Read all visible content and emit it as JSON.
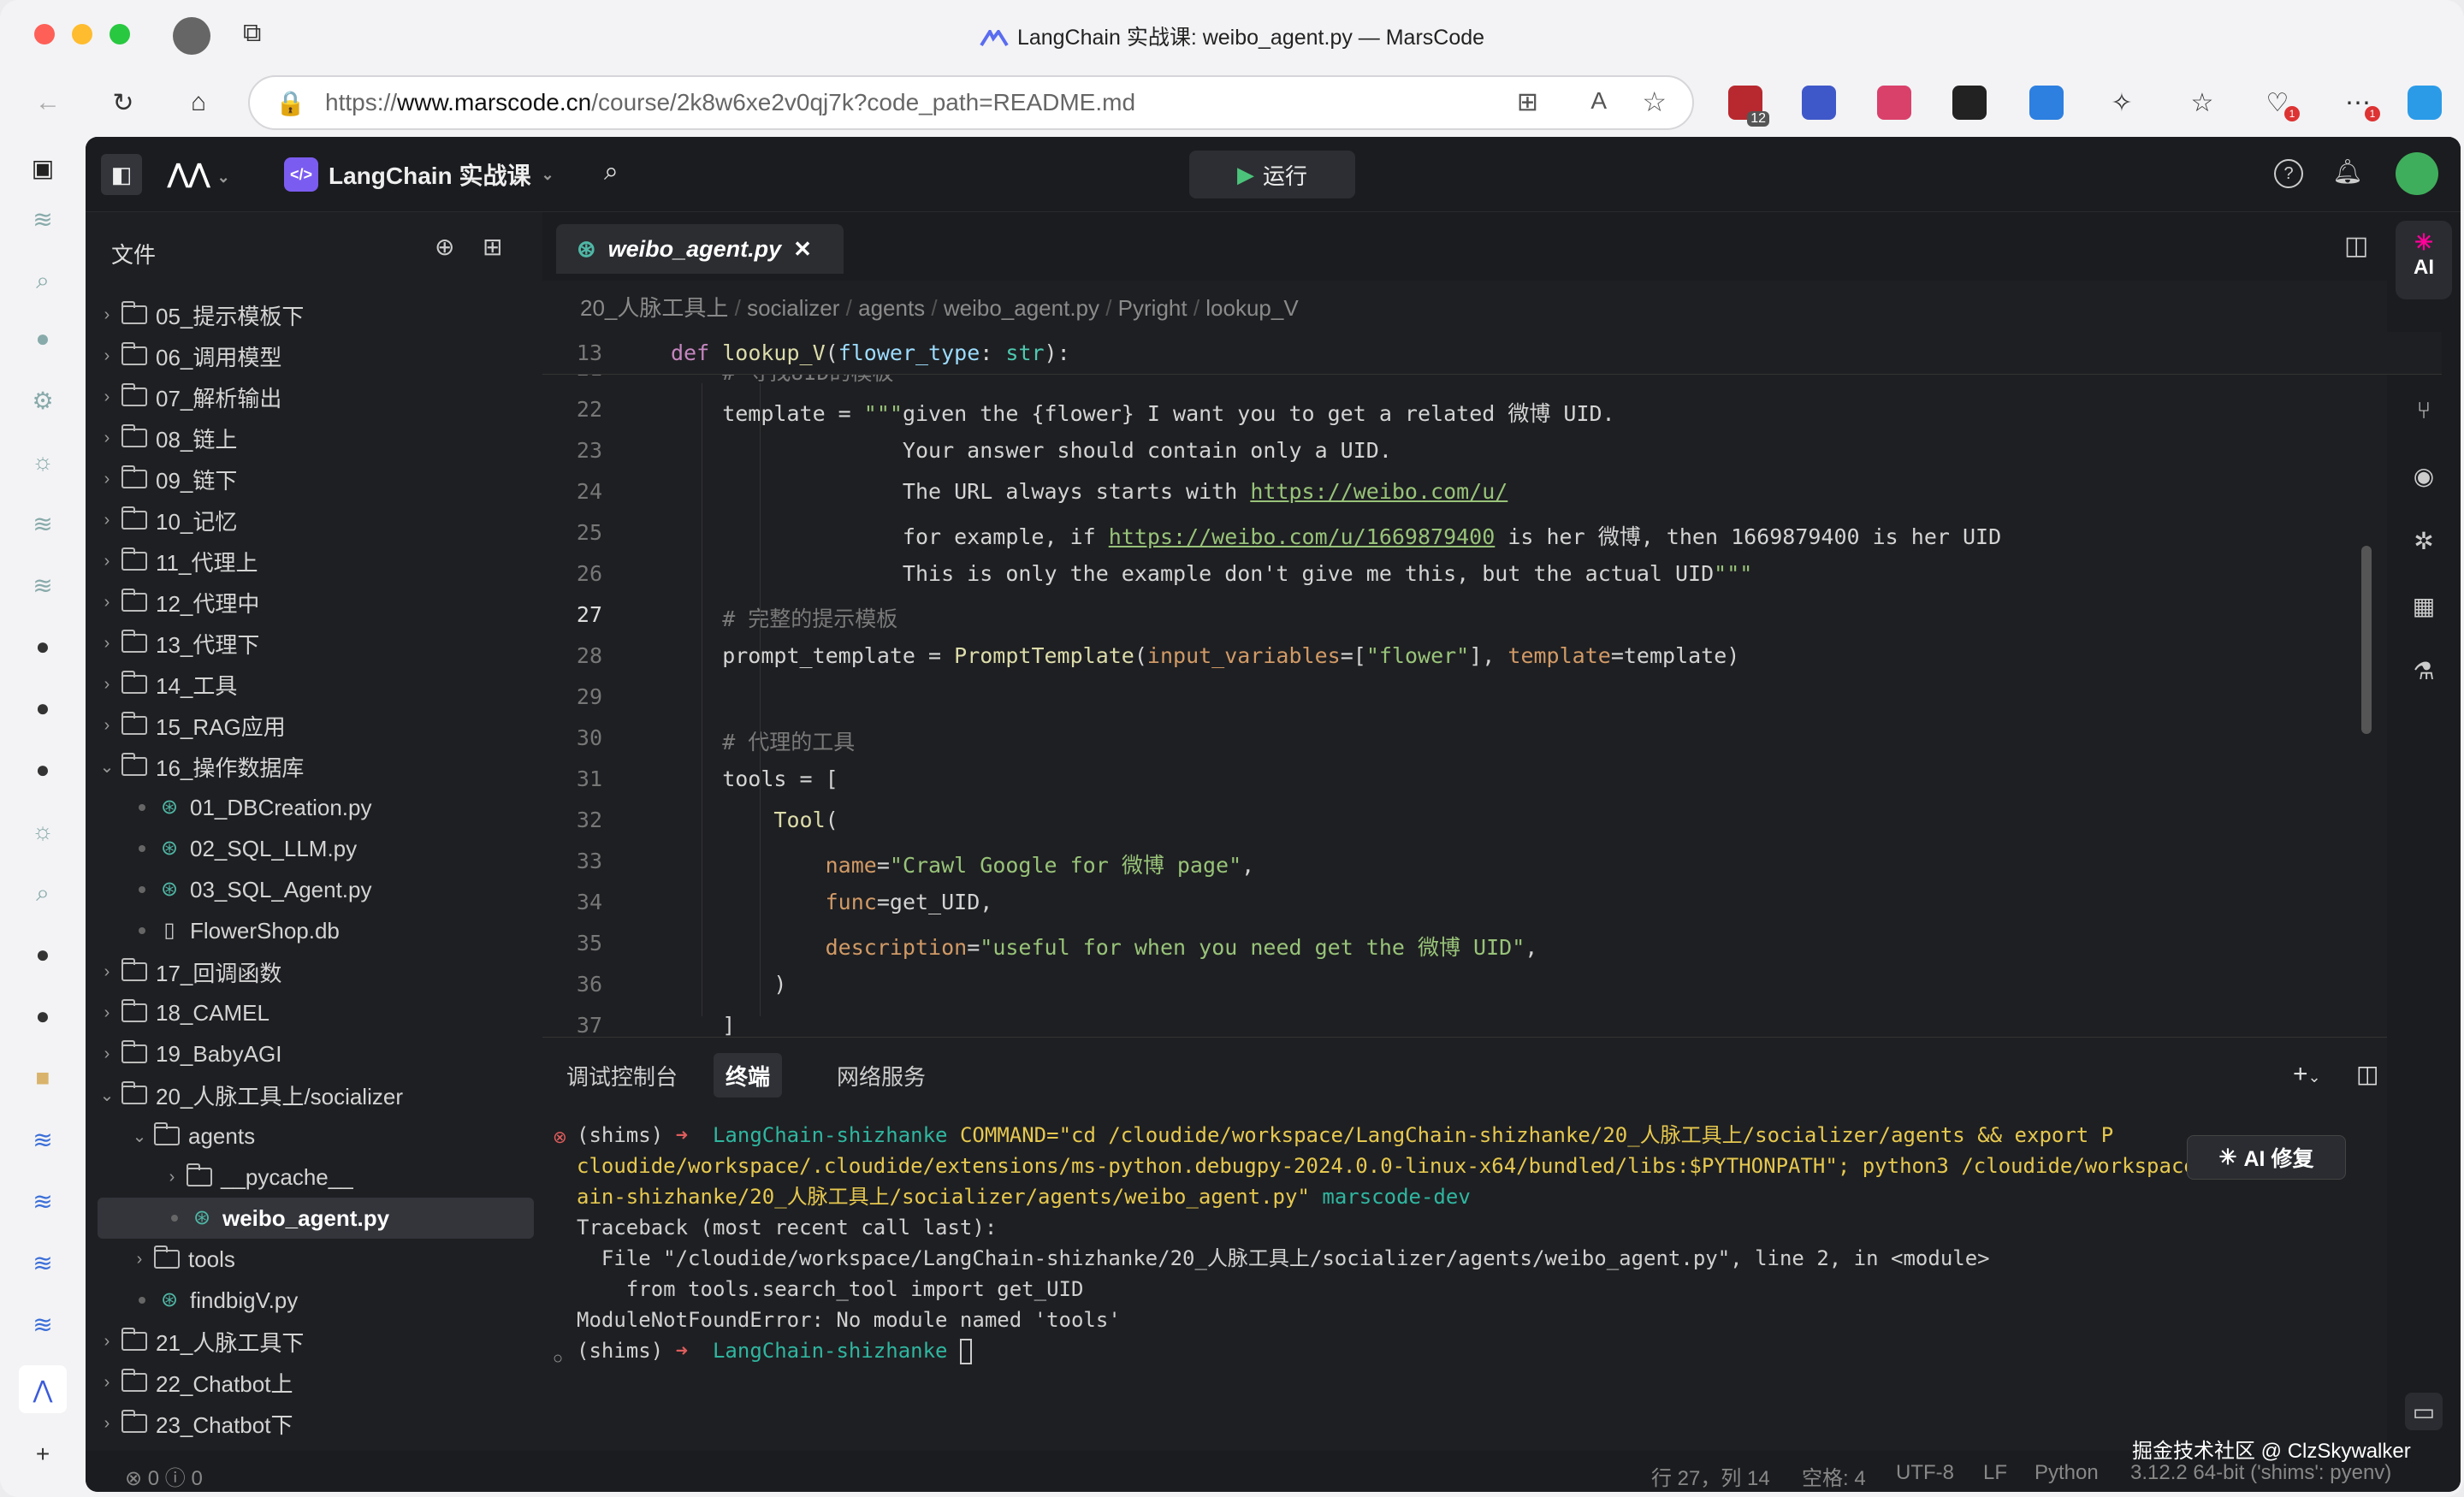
{
  "window": {
    "title": "LangChain 实战课: weibo_agent.py — MarsCode"
  },
  "browser": {
    "url_scheme": "https://",
    "url_host": "www.marscode.cn",
    "url_path": "/course/2k8w6xe2v0qj7k?code_path=README.md",
    "ext_badge_1": "12",
    "ext_badge_2": "1",
    "ext_badge_3": "1"
  },
  "ide": {
    "project": "LangChain 实战课",
    "run_label": "运行",
    "explorer_title": "文件",
    "ai_label": "AI"
  },
  "tree": [
    {
      "name": "05_提示模板下",
      "type": "folder",
      "level": 0,
      "open": false
    },
    {
      "name": "06_调用模型",
      "type": "folder",
      "level": 0,
      "open": false
    },
    {
      "name": "07_解析输出",
      "type": "folder",
      "level": 0,
      "open": false
    },
    {
      "name": "08_链上",
      "type": "folder",
      "level": 0,
      "open": false
    },
    {
      "name": "09_链下",
      "type": "folder",
      "level": 0,
      "open": false
    },
    {
      "name": "10_记忆",
      "type": "folder",
      "level": 0,
      "open": false
    },
    {
      "name": "11_代理上",
      "type": "folder",
      "level": 0,
      "open": false
    },
    {
      "name": "12_代理中",
      "type": "folder",
      "level": 0,
      "open": false
    },
    {
      "name": "13_代理下",
      "type": "folder",
      "level": 0,
      "open": false
    },
    {
      "name": "14_工具",
      "type": "folder",
      "level": 0,
      "open": false
    },
    {
      "name": "15_RAG应用",
      "type": "folder",
      "level": 0,
      "open": false
    },
    {
      "name": "16_操作数据库",
      "type": "folder",
      "level": 0,
      "open": true
    },
    {
      "name": "01_DBCreation.py",
      "type": "py",
      "level": 1
    },
    {
      "name": "02_SQL_LLM.py",
      "type": "py",
      "level": 1
    },
    {
      "name": "03_SQL_Agent.py",
      "type": "py",
      "level": 1
    },
    {
      "name": "FlowerShop.db",
      "type": "file",
      "level": 1
    },
    {
      "name": "17_回调函数",
      "type": "folder",
      "level": 0,
      "open": false
    },
    {
      "name": "18_CAMEL",
      "type": "folder",
      "level": 0,
      "open": false
    },
    {
      "name": "19_BabyAGI",
      "type": "folder",
      "level": 0,
      "open": false
    },
    {
      "name": "20_人脉工具上/socializer",
      "type": "folder",
      "level": 0,
      "open": true
    },
    {
      "name": "agents",
      "type": "folder",
      "level": 1,
      "open": true
    },
    {
      "name": "__pycache__",
      "type": "folder",
      "level": 2,
      "open": false
    },
    {
      "name": "weibo_agent.py",
      "type": "py",
      "level": 2,
      "selected": true
    },
    {
      "name": "tools",
      "type": "folder",
      "level": 1,
      "open": false
    },
    {
      "name": "findbigV.py",
      "type": "py",
      "level": 1
    },
    {
      "name": "21_人脉工具下",
      "type": "folder",
      "level": 0,
      "open": false
    },
    {
      "name": "22_Chatbot上",
      "type": "folder",
      "level": 0,
      "open": false
    },
    {
      "name": "23_Chatbot下",
      "type": "folder",
      "level": 0,
      "open": false
    }
  ],
  "editor": {
    "tab_name": "weibo_agent.py",
    "breadcrumb": [
      "20_人脉工具上",
      "socializer",
      "agents",
      "weibo_agent.py",
      "Pyright",
      "lookup_V"
    ],
    "sticky_line": "13",
    "sticky_code": "def lookup_V(flower_type: str):",
    "lines": [
      {
        "n": "21",
        "text": "    # 寻找UID的模板"
      },
      {
        "n": "22",
        "text": "    template = \"\"\"given the {flower} I want you to get a related 微博 UID."
      },
      {
        "n": "23",
        "text": "                  Your answer should contain only a UID."
      },
      {
        "n": "24",
        "text": "                  The URL always starts with https://weibo.com/u/"
      },
      {
        "n": "25",
        "text": "                  for example, if https://weibo.com/u/1669879400 is her 微博, then 1669879400 is her UID"
      },
      {
        "n": "26",
        "text": "                  This is only the example don't give me this, but the actual UID\"\"\""
      },
      {
        "n": "27",
        "text": "    # 完整的提示模板"
      },
      {
        "n": "28",
        "text": "    prompt_template = PromptTemplate(input_variables=[\"flower\"], template=template)"
      },
      {
        "n": "29",
        "text": ""
      },
      {
        "n": "30",
        "text": "    # 代理的工具"
      },
      {
        "n": "31",
        "text": "    tools = ["
      },
      {
        "n": "32",
        "text": "        Tool("
      },
      {
        "n": "33",
        "text": "            name=\"Crawl Google for 微博 page\","
      },
      {
        "n": "34",
        "text": "            func=get_UID,"
      },
      {
        "n": "35",
        "text": "            description=\"useful for when you need get the 微博 UID\","
      },
      {
        "n": "36",
        "text": "        )"
      },
      {
        "n": "37",
        "text": "    ]"
      },
      {
        "n": "38",
        "text": ""
      }
    ]
  },
  "panel": {
    "tabs": [
      "调试控制台",
      "终端",
      "网络服务"
    ],
    "ai_fix": "AI 修复",
    "terminal": {
      "l1_env": "(shims)",
      "l1_arrow": "➜",
      "l1_dir": "LangChain-shizhanke",
      "l1_cmd": "COMMAND=\"cd /cloudide/workspace/LangChain-shizhanke/20_人脉工具上/socializer/agents && export P",
      "l2": "cloudide/workspace/.cloudide/extensions/ms-python.debugpy-2024.0.0-linux-x64/bundled/libs:$PYTHONPATH\"; python3 /cloudide/workspace/Langch",
      "l3_path": "ain-shizhanke/20_人脉工具上/socializer/agents/weibo_agent.py\"",
      "l3_host": "marscode-dev",
      "l4": "Traceback (most recent call last):",
      "l5": "  File \"/cloudide/workspace/LangChain-shizhanke/20_人脉工具上/socializer/agents/weibo_agent.py\", line 2, in <module>",
      "l6": "    from tools.search_tool import get_UID",
      "l7": "ModuleNotFoundError: No module named 'tools'",
      "l8_env": "(shims)",
      "l8_arrow": "➜",
      "l8_dir": "LangChain-shizhanke"
    }
  },
  "status": {
    "errors": "0",
    "warnings": "0",
    "position": "行 27，列 14",
    "spaces": "空格: 4",
    "encoding": "UTF-8",
    "eol": "LF",
    "language": "Python",
    "interpreter": "3.12.2 64-bit ('shims': pyenv)",
    "watermark": "掘金技术社区 @ ClzSkywalker"
  }
}
